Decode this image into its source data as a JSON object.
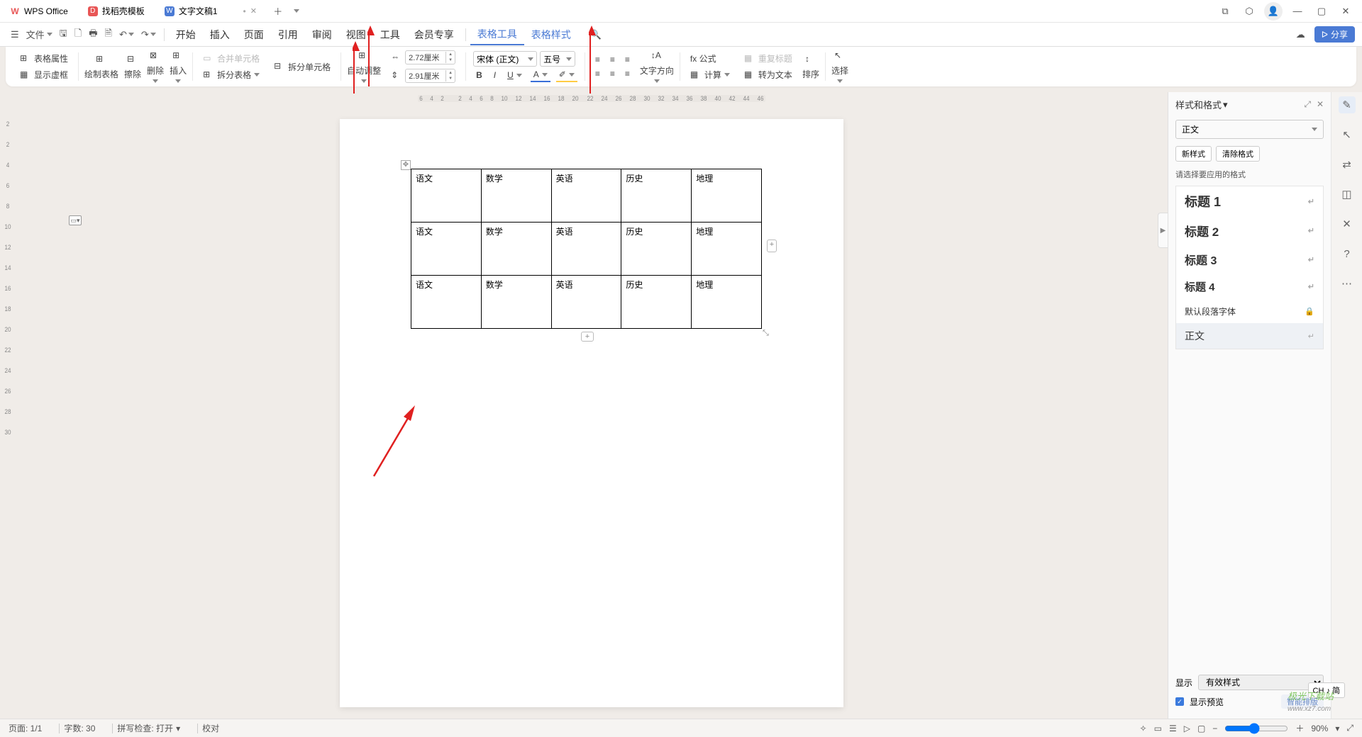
{
  "titlebar": {
    "app_name": "WPS Office",
    "tabs": [
      {
        "label": "找稻壳模板",
        "icon": "D",
        "icon_color": "#e85656"
      },
      {
        "label": "文字文稿1",
        "icon": "W",
        "icon_color": "#4a7ad4",
        "active": true,
        "dirty": "•"
      }
    ],
    "add": "＋"
  },
  "menubar": {
    "file": "文件",
    "items": [
      "开始",
      "插入",
      "页面",
      "引用",
      "审阅",
      "视图",
      "工具",
      "会员专享"
    ],
    "table_tools": "表格工具",
    "table_style": "表格样式",
    "share": "分享"
  },
  "ribbon": {
    "table_props": "表格属性",
    "show_grid": "显示虚框",
    "draw_table": "绘制表格",
    "erase": "擦除",
    "delete": "删除",
    "insert": "插入",
    "merge_cells": "合并单元格",
    "split_table": "拆分表格",
    "split_cells": "拆分单元格",
    "auto_fit": "自动调整",
    "width_val": "2.72厘米",
    "height_val": "2.91厘米",
    "font_name": "宋体 (正文)",
    "font_size": "五号",
    "text_dir": "文字方向",
    "formula": "fx 公式",
    "calc": "计算",
    "repeat_header": "重复标题",
    "to_text": "转为文本",
    "sort": "排序",
    "select": "选择"
  },
  "hruler": [
    "6",
    "4",
    "2",
    "",
    "2",
    "4",
    "6",
    "8",
    "10",
    "12",
    "14",
    "16",
    "18",
    "20",
    "22",
    "24",
    "26",
    "28",
    "30",
    "32",
    "34",
    "36",
    "38",
    "40",
    "42",
    "44",
    "46"
  ],
  "vruler": [
    "2",
    "",
    "2",
    "4",
    "6",
    "8",
    "10",
    "12",
    "14",
    "16",
    "18",
    "20",
    "22",
    "24",
    "26",
    "28",
    "30"
  ],
  "table": {
    "rows": [
      [
        "语文",
        "数学",
        "英语",
        "历史",
        "地理"
      ],
      [
        "语文",
        "数学",
        "英语",
        "历史",
        "地理"
      ],
      [
        "语文",
        "数学",
        "英语",
        "历史",
        "地理"
      ]
    ]
  },
  "styles_panel": {
    "title": "样式和格式",
    "current": "正文",
    "new_style": "新样式",
    "clear_format": "清除格式",
    "hint": "请选择要应用的格式",
    "items": [
      {
        "label": "标题 1",
        "cls": "h1"
      },
      {
        "label": "标题 2",
        "cls": "h2"
      },
      {
        "label": "标题 3",
        "cls": "h3"
      },
      {
        "label": "标题 4",
        "cls": "h4"
      },
      {
        "label": "默认段落字体",
        "cls": "def",
        "lock": true
      },
      {
        "label": "正文",
        "cls": "sel"
      }
    ],
    "show_label": "显示",
    "show_value": "有效样式",
    "preview_label": "显示预览",
    "smart_layout": "智能排版"
  },
  "statusbar": {
    "page": "页面: 1/1",
    "words": "字数: 30",
    "spell": "拼写检查: 打开",
    "proof": "校对",
    "zoom": "90%"
  },
  "ime": "CH ♪ 简",
  "watermark": {
    "main": "极光下载站",
    "sub": "www.xz7.com"
  }
}
